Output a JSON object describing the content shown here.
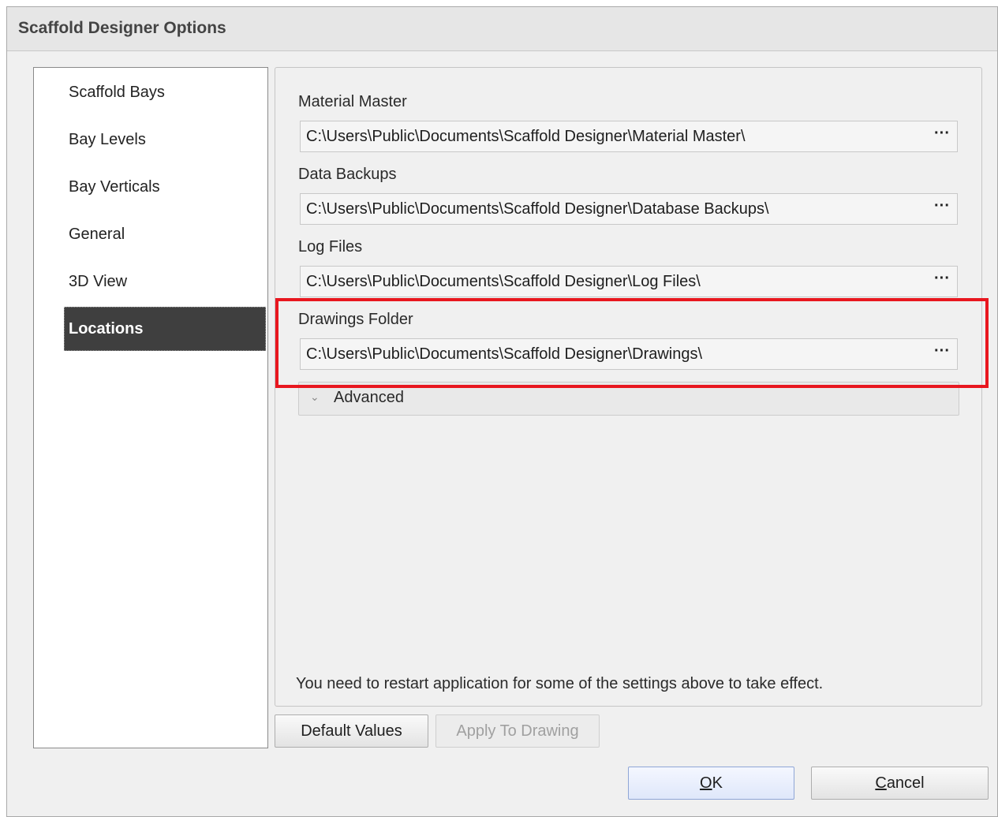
{
  "window": {
    "title": "Scaffold Designer Options"
  },
  "nav": {
    "items": [
      {
        "label": "Scaffold Bays"
      },
      {
        "label": "Bay Levels"
      },
      {
        "label": "Bay Verticals"
      },
      {
        "label": "General"
      },
      {
        "label": "3D View"
      },
      {
        "label": "Locations"
      }
    ],
    "selected": "Locations"
  },
  "locations": {
    "fields": [
      {
        "label": "Material Master",
        "value": "C:\\Users\\Public\\Documents\\Scaffold Designer\\Material Master\\",
        "browse": "···"
      },
      {
        "label": "Data Backups",
        "value": "C:\\Users\\Public\\Documents\\Scaffold Designer\\Database Backups\\",
        "browse": "···"
      },
      {
        "label": "Log Files",
        "value": "C:\\Users\\Public\\Documents\\Scaffold Designer\\Log Files\\",
        "browse": "···"
      },
      {
        "label": "Drawings Folder",
        "value": "C:\\Users\\Public\\Documents\\Scaffold Designer\\Drawings\\",
        "browse": "···"
      }
    ],
    "advanced": {
      "label": "Advanced",
      "chevron": "⌄"
    },
    "note": "You need to restart application for  some of the settings above to take effect."
  },
  "buttons": {
    "default_values": "Default Values",
    "apply_to_drawing": "Apply To Drawing",
    "ok_mnemonic": "O",
    "ok_rest": "K",
    "cancel_mnemonic": "C",
    "cancel_rest": "ancel"
  },
  "colors": {
    "selected_nav_bg": "#3f3f3f",
    "highlight_border": "#e8171f"
  }
}
